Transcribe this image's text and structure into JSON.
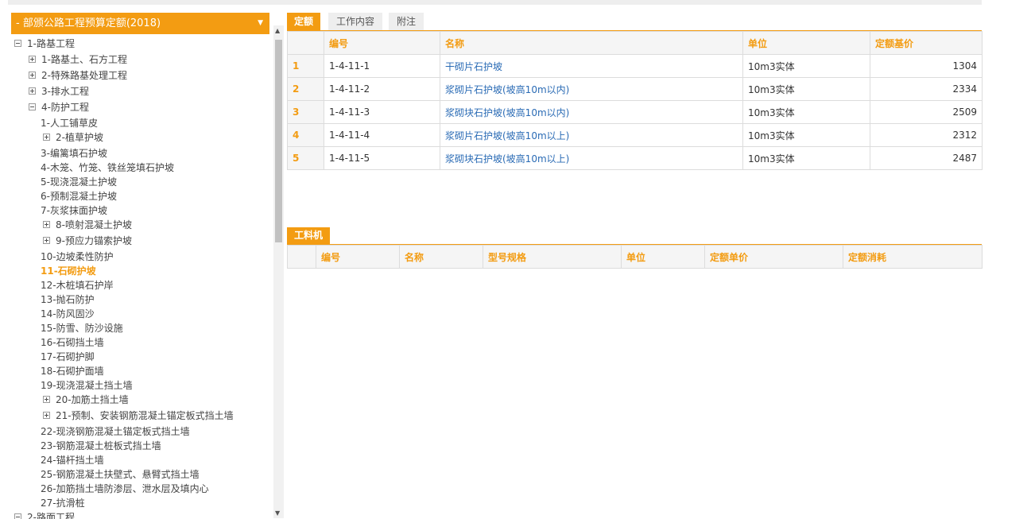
{
  "selector": {
    "title": "- 部颁公路工程预算定额(2018)",
    "arrow": "▼"
  },
  "tree": [
    {
      "label": "1-路基工程",
      "toggle": "minus",
      "level": 0
    },
    {
      "label": "1-路基土、石方工程",
      "toggle": "plus",
      "level": 1
    },
    {
      "label": "2-特殊路基处理工程",
      "toggle": "plus",
      "level": 1
    },
    {
      "label": "3-排水工程",
      "toggle": "plus",
      "level": 1
    },
    {
      "label": "4-防护工程",
      "toggle": "minus",
      "level": 1
    },
    {
      "label": "1-人工铺草皮",
      "toggle": "",
      "level": 2
    },
    {
      "label": "2-植草护坡",
      "toggle": "plus",
      "level": 2
    },
    {
      "label": "3-编篱填石护坡",
      "toggle": "",
      "level": 2
    },
    {
      "label": "4-木笼、竹笼、铁丝笼填石护坡",
      "toggle": "",
      "level": 2
    },
    {
      "label": "5-现浇混凝土护坡",
      "toggle": "",
      "level": 2
    },
    {
      "label": "6-预制混凝土护坡",
      "toggle": "",
      "level": 2
    },
    {
      "label": "7-灰浆抹面护坡",
      "toggle": "",
      "level": 2
    },
    {
      "label": "8-喷射混凝土护坡",
      "toggle": "plus",
      "level": 2
    },
    {
      "label": "9-预应力锚索护坡",
      "toggle": "plus",
      "level": 2
    },
    {
      "label": "10-边坡柔性防护",
      "toggle": "",
      "level": 2
    },
    {
      "label": "11-石砌护坡",
      "toggle": "",
      "level": 2,
      "active": true
    },
    {
      "label": "12-木桩填石护岸",
      "toggle": "",
      "level": 2
    },
    {
      "label": "13-抛石防护",
      "toggle": "",
      "level": 2
    },
    {
      "label": "14-防风固沙",
      "toggle": "",
      "level": 2
    },
    {
      "label": "15-防雪、防沙设施",
      "toggle": "",
      "level": 2
    },
    {
      "label": "16-石砌挡土墙",
      "toggle": "",
      "level": 2
    },
    {
      "label": "17-石砌护脚",
      "toggle": "",
      "level": 2
    },
    {
      "label": "18-石砌护面墙",
      "toggle": "",
      "level": 2
    },
    {
      "label": "19-现浇混凝土挡土墙",
      "toggle": "",
      "level": 2
    },
    {
      "label": "20-加筋土挡土墙",
      "toggle": "plus",
      "level": 2
    },
    {
      "label": "21-预制、安装钢筋混凝土锚定板式挡土墙",
      "toggle": "plus",
      "level": 2
    },
    {
      "label": "22-现浇钢筋混凝土锚定板式挡土墙",
      "toggle": "",
      "level": 2
    },
    {
      "label": "23-钢筋混凝土桩板式挡土墙",
      "toggle": "",
      "level": 2
    },
    {
      "label": "24-锚杆挡土墙",
      "toggle": "",
      "level": 2
    },
    {
      "label": "25-钢筋混凝土扶壁式、悬臂式挡土墙",
      "toggle": "",
      "level": 2
    },
    {
      "label": "26-加筋挡土墙防渗层、泄水层及填内心",
      "toggle": "",
      "level": 2
    },
    {
      "label": "27-抗滑桩",
      "toggle": "",
      "level": 2
    },
    {
      "label": "2-路面工程",
      "toggle": "minus",
      "level": 0
    }
  ],
  "tabs": [
    {
      "label": "定额",
      "active": true
    },
    {
      "label": "工作内容",
      "active": false
    },
    {
      "label": "附注",
      "active": false
    }
  ],
  "quota_table": {
    "headers": [
      "",
      "编号",
      "名称",
      "单位",
      "定额基价"
    ],
    "rows": [
      {
        "idx": "1",
        "code": "1-4-11-1",
        "name": "干砌片石护坡",
        "unit": "10m3实体",
        "price": "1304"
      },
      {
        "idx": "2",
        "code": "1-4-11-2",
        "name": "浆砌片石护坡(坡高10m以内)",
        "unit": "10m3实体",
        "price": "2334"
      },
      {
        "idx": "3",
        "code": "1-4-11-3",
        "name": "浆砌块石护坡(坡高10m以内)",
        "unit": "10m3实体",
        "price": "2509"
      },
      {
        "idx": "4",
        "code": "1-4-11-4",
        "name": "浆砌片石护坡(坡高10m以上)",
        "unit": "10m3实体",
        "price": "2312"
      },
      {
        "idx": "5",
        "code": "1-4-11-5",
        "name": "浆砌块石护坡(坡高10m以上)",
        "unit": "10m3实体",
        "price": "2487"
      }
    ]
  },
  "labor": {
    "tab_label": "工料机",
    "headers": [
      "",
      "编号",
      "名称",
      "型号规格",
      "单位",
      "定额单价",
      "定额消耗"
    ]
  },
  "colors": {
    "accent": "#f39c12",
    "link": "#2a6bb5"
  }
}
